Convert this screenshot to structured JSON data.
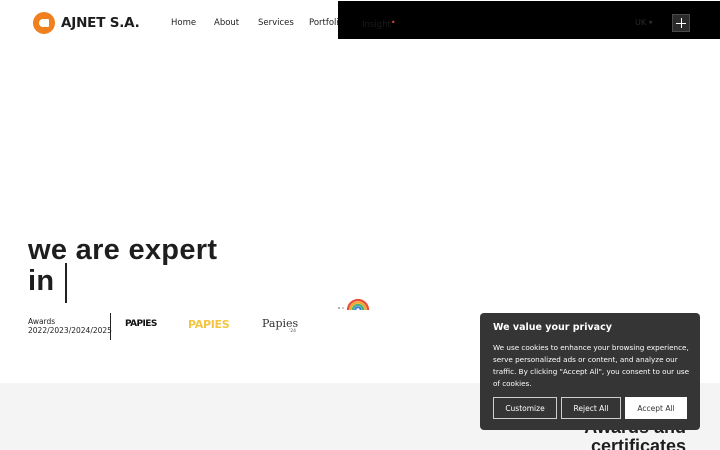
{
  "header": {
    "logo_text": "AJNET S.A.",
    "nav": [
      {
        "label": "Home"
      },
      {
        "label": "About"
      },
      {
        "label": "Services"
      },
      {
        "label": "Portfolio"
      },
      {
        "label": "Insight"
      }
    ],
    "insight_marker": "•",
    "language": "UK",
    "language_chevron": "▾",
    "menu_icon": "plus-icon"
  },
  "hero": {
    "line1": "we are expert",
    "line2": "in"
  },
  "awards": {
    "label": "Awards",
    "years": "2022/2023/2024/2025",
    "logos": [
      {
        "text": "PAPIES",
        "icon": "papies-logo-dark"
      },
      {
        "text": "PAPIES",
        "icon": "papies-logo-pastel"
      },
      {
        "text": "Papies",
        "sub": "'24",
        "icon": "papies-logo-serif"
      },
      {
        "icon": "rainbow-award-icon"
      }
    ]
  },
  "section2": {
    "title_line1": "Awards and",
    "title_line2": "certificates"
  },
  "cookie_banner": {
    "title": "We value your privacy",
    "body": "We use cookies to enhance your browsing experience, serve personalized ads or content, and analyze our traffic. By clicking \"Accept All\", you consent to our use of cookies.",
    "customize_label": "Customize",
    "reject_label": "Reject All",
    "accept_label": "Accept All"
  },
  "colors": {
    "brand_orange": "#f07f1d",
    "cookie_bg": "#353535",
    "overlay_bar": "#000000",
    "gray_band": "#f4f4f4"
  }
}
